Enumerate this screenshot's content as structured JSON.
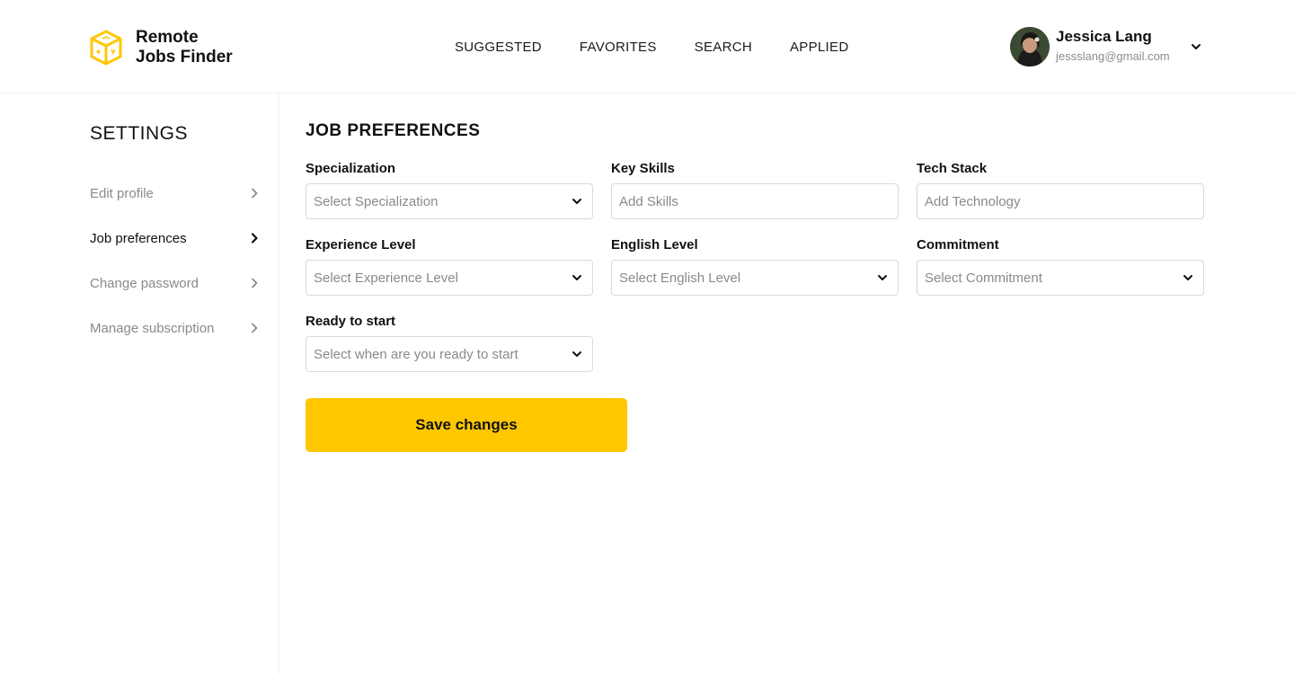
{
  "brand": {
    "line1": "Remote",
    "line2": "Jobs Finder",
    "icon": "cube-logo-icon",
    "accent": "#ffc700"
  },
  "nav": [
    {
      "label": "SUGGESTED"
    },
    {
      "label": "FAVORITES"
    },
    {
      "label": "SEARCH"
    },
    {
      "label": "APPLIED"
    }
  ],
  "user": {
    "name": "Jessica Lang",
    "email": "jessslang@gmail.com",
    "caret_icon": "chevron-down-icon"
  },
  "sidebar": {
    "title": "SETTINGS",
    "items": [
      {
        "label": "Edit profile",
        "active": false
      },
      {
        "label": "Job preferences",
        "active": true
      },
      {
        "label": "Change password",
        "active": false
      },
      {
        "label": "Manage subscription",
        "active": false
      }
    ]
  },
  "main": {
    "title": "JOB PREFERENCES",
    "fields": {
      "specialization": {
        "label": "Specialization",
        "placeholder": "Select Specialization"
      },
      "key_skills": {
        "label": "Key Skills",
        "placeholder": "Add Skills"
      },
      "tech_stack": {
        "label": "Tech Stack",
        "placeholder": "Add Technology"
      },
      "experience": {
        "label": "Experience Level",
        "placeholder": "Select Experience Level"
      },
      "english": {
        "label": "English Level",
        "placeholder": "Select English Level"
      },
      "commitment": {
        "label": "Commitment",
        "placeholder": "Select Commitment"
      },
      "ready": {
        "label": "Ready to start",
        "placeholder": "Select when are you ready to start"
      }
    },
    "save_label": "Save changes"
  }
}
